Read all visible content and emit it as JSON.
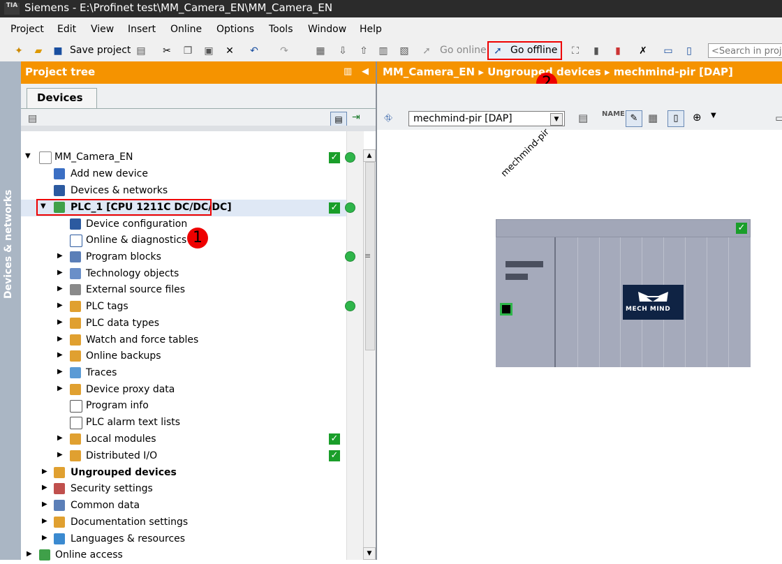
{
  "window": {
    "app_icon_text": "TIA",
    "title": "Siemens - E:\\Profinet test\\MM_Camera_EN\\MM_Camera_EN"
  },
  "menu": [
    "Project",
    "Edit",
    "View",
    "Insert",
    "Online",
    "Options",
    "Tools",
    "Window",
    "Help"
  ],
  "toolbar": {
    "save_label": "Save project",
    "go_online_label": "Go online",
    "go_offline_label": "Go offline",
    "search_placeholder": "<Search in proj"
  },
  "sidebar_strip": {
    "label": "Devices & networks"
  },
  "project_tree": {
    "title": "Project tree",
    "tab": "Devices",
    "items": [
      {
        "label": "MM_Camera_EN",
        "icon": "project-icon"
      },
      {
        "label": "Add new device",
        "icon": "add-device-icon"
      },
      {
        "label": "Devices & networks",
        "icon": "network-icon"
      },
      {
        "label": "PLC_1 [CPU 1211C DC/DC/DC]",
        "icon": "plc-icon"
      },
      {
        "label": "Device configuration",
        "icon": "device-config-icon"
      },
      {
        "label": "Online & diagnostics",
        "icon": "diagnostics-icon"
      },
      {
        "label": "Program blocks",
        "icon": "folder-icon"
      },
      {
        "label": "Technology objects",
        "icon": "folder-icon"
      },
      {
        "label": "External source files",
        "icon": "folder-icon"
      },
      {
        "label": "PLC tags",
        "icon": "folder-icon"
      },
      {
        "label": "PLC data types",
        "icon": "folder-icon"
      },
      {
        "label": "Watch and force tables",
        "icon": "folder-icon"
      },
      {
        "label": "Online backups",
        "icon": "folder-icon"
      },
      {
        "label": "Traces",
        "icon": "folder-icon"
      },
      {
        "label": "Device proxy data",
        "icon": "folder-icon"
      },
      {
        "label": "Program info",
        "icon": "program-info-icon"
      },
      {
        "label": "PLC alarm text lists",
        "icon": "text-list-icon"
      },
      {
        "label": "Local modules",
        "icon": "folder-icon"
      },
      {
        "label": "Distributed I/O",
        "icon": "folder-icon"
      },
      {
        "label": "Ungrouped devices",
        "icon": "folder-icon"
      },
      {
        "label": "Security settings",
        "icon": "security-icon"
      },
      {
        "label": "Common data",
        "icon": "folder-icon"
      },
      {
        "label": "Documentation settings",
        "icon": "folder-icon"
      },
      {
        "label": "Languages & resources",
        "icon": "folder-icon"
      },
      {
        "label": "Online access",
        "icon": "folder-icon"
      }
    ]
  },
  "editor": {
    "breadcrumb": [
      "MM_Camera_EN",
      "Ungrouped devices",
      "mechmind-pir [DAP]"
    ],
    "device_select": "mechmind-pir [DAP]",
    "device_label": "mechmind-pir",
    "logo_text": "MECH MIND"
  },
  "annotations": {
    "badge1": "1",
    "badge2": "2"
  },
  "colors": {
    "orange": "#f59300",
    "highlight_red": "#e00000",
    "status_green": "#2fb54a"
  }
}
